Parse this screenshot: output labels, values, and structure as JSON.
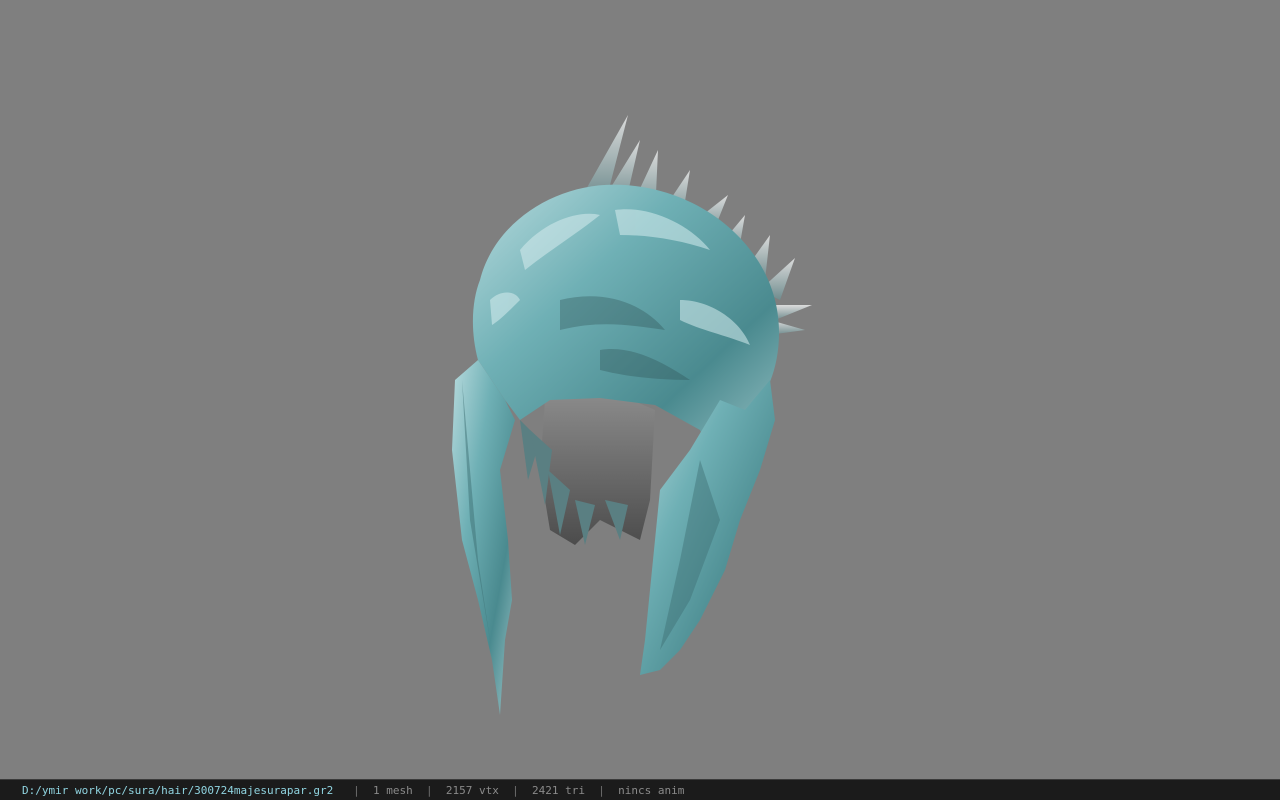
{
  "window": {
    "background": "#7f7f7f"
  },
  "model": {
    "name": "hair-mesh",
    "primary_color": "#5e9da2",
    "shadow_color": "#2f5255",
    "inner_color": "#6a6a6a"
  },
  "statusbar": {
    "file_path": "D:/ymir work/pc/sura/hair/300724majesurapar.gr2",
    "separator": "|",
    "mesh_count": "1 mesh",
    "vertex_count": "2157 vtx",
    "triangle_count": "2421 tri",
    "anim_status": "nincs anim"
  }
}
